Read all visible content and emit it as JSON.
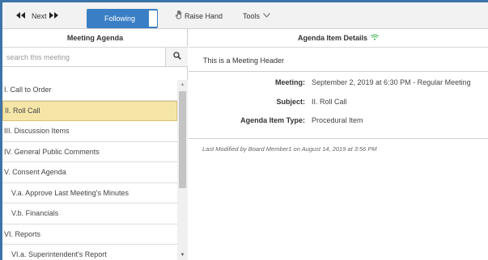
{
  "toolbar": {
    "prev_icon": "double-arrow-left-icon",
    "next_label": "Next",
    "next_icon": "double-arrow-right-icon",
    "following_label": "Following",
    "raise_hand_label": "Raise Hand",
    "raise_hand_icon": "hand-icon",
    "tools_label": "Tools",
    "tools_icon": "chevron-down-icon"
  },
  "agenda": {
    "title": "Meeting Agenda",
    "search_placeholder": "search this meeting",
    "search_icon": "search-icon",
    "items": [
      {
        "label": "I. Call to Order",
        "selected": false,
        "sub": false
      },
      {
        "label": "II. Roll Call",
        "selected": true,
        "sub": false
      },
      {
        "label": "III. Discussion Items",
        "selected": false,
        "sub": false
      },
      {
        "label": "IV. General Public Comments",
        "selected": false,
        "sub": false
      },
      {
        "label": "V. Consent Agenda",
        "selected": false,
        "sub": false
      },
      {
        "label": "V.a. Approve Last Meeting's Minutes",
        "selected": false,
        "sub": true
      },
      {
        "label": "V.b. Financials",
        "selected": false,
        "sub": true
      },
      {
        "label": "VI. Reports",
        "selected": false,
        "sub": false
      },
      {
        "label": "VI.a. Superintendent's Report",
        "selected": false,
        "sub": true
      }
    ]
  },
  "details": {
    "title": "Agenda Item Details",
    "status_icon": "wifi-icon",
    "meeting_header": "This is a Meeting Header",
    "rows": [
      {
        "label": "Meeting:",
        "value": "September 2, 2019 at 6:30 PM - Regular Meeting"
      },
      {
        "label": "Subject:",
        "value": "II. Roll Call"
      },
      {
        "label": "Agenda Item Type:",
        "value": "Procedural Item"
      }
    ],
    "last_modified": "Last Modified by Board Member1 on August 14, 2019 at 3:56 PM"
  },
  "colors": {
    "accent": "#3a7fc5",
    "frame": "#3c73a8",
    "selected_bg": "#f5e6a8",
    "status_green": "#2fae3f"
  }
}
